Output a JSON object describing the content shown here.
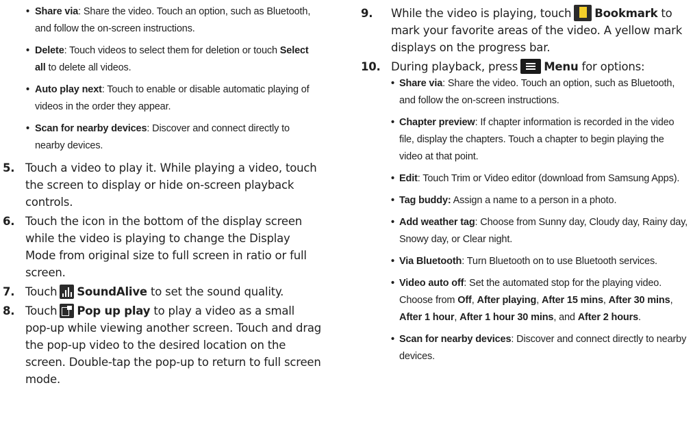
{
  "left": {
    "bullets_top": [
      {
        "term": "Share via",
        "text": ": Share the video. Touch an option, such as Bluetooth, and follow the on-screen instructions."
      },
      {
        "term": "Delete",
        "text": ": Touch videos to select them for deletion or touch ",
        "term2": "Select all",
        "text2": " to delete all videos."
      },
      {
        "term": "Auto play next",
        "text": ": Touch to enable or disable automatic playing of videos in the order they appear."
      },
      {
        "term": "Scan for nearby devices",
        "text": ": Discover and connect directly to nearby devices."
      }
    ],
    "step5": {
      "num": "5.",
      "text": "Touch a video to play it. While playing a video, touch the screen to display or hide on-screen playback controls."
    },
    "step6": {
      "num": "6.",
      "text": "Touch the icon in the bottom of the display screen while the video is playing to change the Display Mode from original size to full screen in ratio or full screen."
    },
    "step7": {
      "num": "7.",
      "pre": "Touch",
      "icon": "soundalive-icon",
      "term": "SoundAlive",
      "post": " to set the sound quality."
    },
    "step8": {
      "num": "8.",
      "pre": "Touch",
      "icon": "popup-play-icon",
      "term": "Pop up play",
      "post": " to play a video as a small pop-up while viewing another screen. Touch and drag the pop-up video to the desired location on the screen. Double-tap the pop-up to return to full screen mode."
    }
  },
  "right": {
    "step9": {
      "num": "9.",
      "pre": "While the video is playing, touch",
      "icon": "bookmark-icon",
      "term": "Bookmark",
      "post": " to mark your favorite areas of the video. A yellow mark displays on the progress bar."
    },
    "step10": {
      "num": "10.",
      "pre": "During playback, press",
      "icon": "menu-icon",
      "term": "Menu",
      "post": " for options:"
    },
    "bullets": [
      {
        "term": "Share via",
        "text": ": Share the video. Touch an option, such as Bluetooth, and follow the on-screen instructions."
      },
      {
        "term": "Chapter preview",
        "text": ": If chapter information is recorded in the video file, display the chapters. Touch a chapter to begin playing the video at that point."
      },
      {
        "term": "Edit",
        "text": ": Touch Trim or Video editor (download from Samsung Apps)."
      },
      {
        "term": "Tag buddy:",
        "text": " Assign a name to a person in a photo."
      },
      {
        "term": "Add weather tag",
        "text": ": Choose from Sunny day, Cloudy day, Rainy day, Snowy day, or Clear night."
      },
      {
        "term": "Via Bluetooth",
        "text": ": Turn Bluetooth on to use Bluetooth services."
      }
    ],
    "video_auto_off": {
      "term": "Video auto off",
      "text": ": Set the automated stop for the playing video. Choose from ",
      "opts": [
        "Off",
        "After playing",
        "After 15 mins",
        "After 30 mins",
        "After 1 hour",
        "After 1 hour 30 mins",
        "After 2 hours"
      ],
      "sep1": ", ",
      "sep_and": ", and ",
      "end": "."
    },
    "scan": {
      "term": "Scan for nearby devices",
      "text": ": Discover and connect directly to nearby devices."
    }
  },
  "bullet_char": "•"
}
